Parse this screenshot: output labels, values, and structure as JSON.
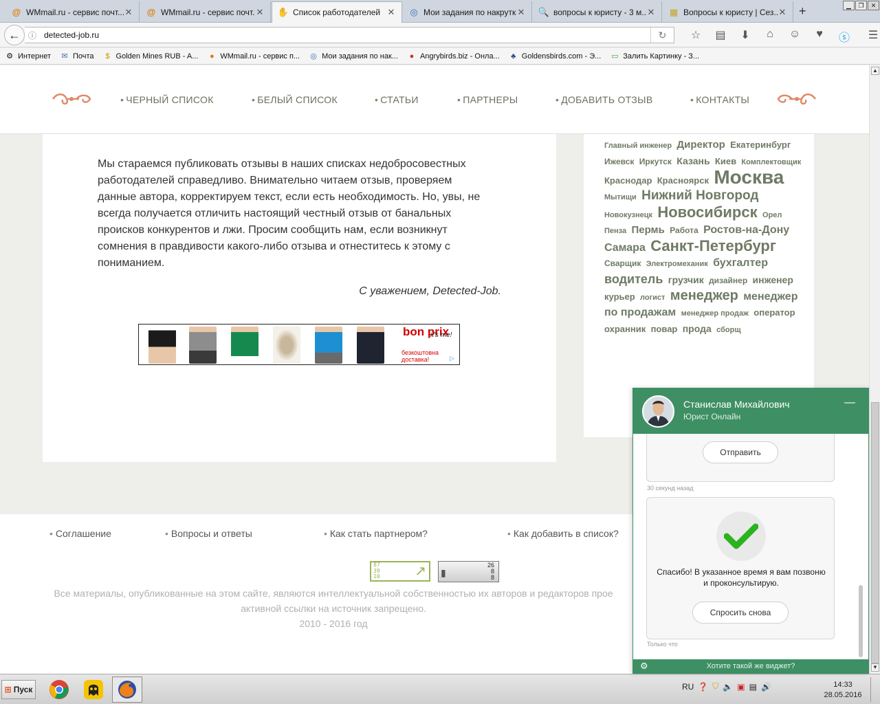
{
  "tabs": [
    {
      "label": "WMmail.ru - сервис почт...",
      "icon": "wmmail-icon",
      "active": false
    },
    {
      "label": "WMmail.ru - сервис почт...",
      "icon": "wmmail-icon",
      "active": false
    },
    {
      "label": "Список работодателей",
      "icon": "hand-icon",
      "active": true
    },
    {
      "label": "Мои задания по накрутке",
      "icon": "swirl-icon",
      "active": false
    },
    {
      "label": "вопросы к юристу - 3 м...",
      "icon": "search-icon",
      "active": false
    },
    {
      "label": "Вопросы к юристу | Сез...",
      "icon": "puzzle-icon",
      "active": false
    }
  ],
  "address": {
    "url": "detected-job.ru"
  },
  "bookmarks": [
    {
      "label": "Интернет",
      "icon": "globe-icon"
    },
    {
      "label": "Почта",
      "icon": "mail-icon"
    },
    {
      "label": "Golden Mines RUB - A...",
      "icon": "coin-icon"
    },
    {
      "label": "WMmail.ru - сервис п...",
      "icon": "wmmail-icon"
    },
    {
      "label": "Мои задания по нак...",
      "icon": "swirl-icon"
    },
    {
      "label": "Angrybirds.biz - Онла...",
      "icon": "bird-icon"
    },
    {
      "label": "Goldensbirds.com - Э...",
      "icon": "birds-icon"
    },
    {
      "label": "Залить Картинку - З...",
      "icon": "picture-icon"
    }
  ],
  "site_nav": [
    "ЧЕРНЫЙ СПИСОК",
    "БЕЛЫЙ СПИСОК",
    "СТАТЬИ",
    "ПАРТНЕРЫ",
    "ДОБАВИТЬ ОТЗЫВ",
    "КОНТАКТЫ"
  ],
  "article": {
    "body": "Мы стараемся публиковать отзывы в наших списках недобросовестных работодателей справедливо. Внимательно читаем отзыв, проверяем данные автора, корректируем текст, если есть необходимость. Но, увы, не всегда получается отличить настоящий честный отзыв от банальных происков конкурентов и лжи. Просим сообщить нам, если возникнут сомнения в правдивости какого-либо отзыва и отнеститесь к этому с пониманием.",
    "signature": "С уважением, Detected-Job."
  },
  "ad": {
    "brand": "bon prix",
    "slogan": "it's me!",
    "offer": "безкоштовна доставка!"
  },
  "tag_cloud": [
    {
      "text": "Главный инженер",
      "size": 11
    },
    {
      "text": "Директор",
      "size": 15
    },
    {
      "text": "Екатеринбург",
      "size": 13
    },
    {
      "text": "Ижевск",
      "size": 12
    },
    {
      "text": "Иркутск",
      "size": 12
    },
    {
      "text": "Казань",
      "size": 14
    },
    {
      "text": "Киев",
      "size": 13
    },
    {
      "text": "Комплектовщик",
      "size": 11
    },
    {
      "text": "Краснодар",
      "size": 13
    },
    {
      "text": "Красноярск",
      "size": 13
    },
    {
      "text": "Москва",
      "size": 28
    },
    {
      "text": "Мытищи",
      "size": 11
    },
    {
      "text": "Нижний Новгород",
      "size": 19
    },
    {
      "text": "Новокузнецк",
      "size": 11
    },
    {
      "text": "Новосибирск",
      "size": 22
    },
    {
      "text": "Орел",
      "size": 11
    },
    {
      "text": "Пенза",
      "size": 11
    },
    {
      "text": "Пермь",
      "size": 15
    },
    {
      "text": "Работа",
      "size": 12
    },
    {
      "text": "Ростов-на-Дону",
      "size": 16
    },
    {
      "text": "Самара",
      "size": 16
    },
    {
      "text": "Санкт-Петербург",
      "size": 22
    },
    {
      "text": "Сварщик",
      "size": 12
    },
    {
      "text": "Электромеханик",
      "size": 11
    },
    {
      "text": "бухгалтер",
      "size": 16
    },
    {
      "text": "водитель",
      "size": 18
    },
    {
      "text": "грузчик",
      "size": 14
    },
    {
      "text": "дизайнер",
      "size": 12
    },
    {
      "text": "инженер",
      "size": 14
    },
    {
      "text": "курьер",
      "size": 13
    },
    {
      "text": "логист",
      "size": 11
    },
    {
      "text": "менеджер",
      "size": 20
    },
    {
      "text": "менеджер по продажам",
      "size": 16
    },
    {
      "text": "менеджер продаж",
      "size": 11
    },
    {
      "text": "оператор",
      "size": 13
    },
    {
      "text": "охранник",
      "size": 13
    },
    {
      "text": "повар",
      "size": 13
    },
    {
      "text": "прода",
      "size": 14
    },
    {
      "text": "сборщ",
      "size": 11
    }
  ],
  "footer": {
    "links": [
      "Соглашение",
      "Вопросы и ответы",
      "Как стать партнером?",
      "Как добавить в список?"
    ],
    "copyright_line1": "Все материалы, опубликованные на этом сайте, являются интеллектуальной собственностью их авторов и редакторов прое",
    "copyright_line2": "активной ссылки на источник запрещено.",
    "years": "2010 - 2016 год",
    "counter1_numbers": [
      "87",
      "39",
      "10"
    ],
    "counter2_numbers": [
      "26",
      "8",
      "8"
    ]
  },
  "chat": {
    "agent_name": "Станислав Михайлович",
    "agent_role": "Юрист Онлайн",
    "send_button": "Отправить",
    "timestamp1": "30 секунд назад",
    "thanks_text": "Спасибо! В указанное время я вам позвоню и проконсультирую.",
    "ask_again_button": "Спросить снова",
    "timestamp2": "Только что",
    "footer_link": "Хотите такой же виджет?",
    "header_color": "#3e8f64"
  },
  "taskbar": {
    "start_label": "Пуск",
    "apps": [
      "chrome-icon",
      "ghost-icon",
      "firefox-icon"
    ],
    "lang": "RU",
    "time": "14:33",
    "date": "28.05.2016"
  }
}
